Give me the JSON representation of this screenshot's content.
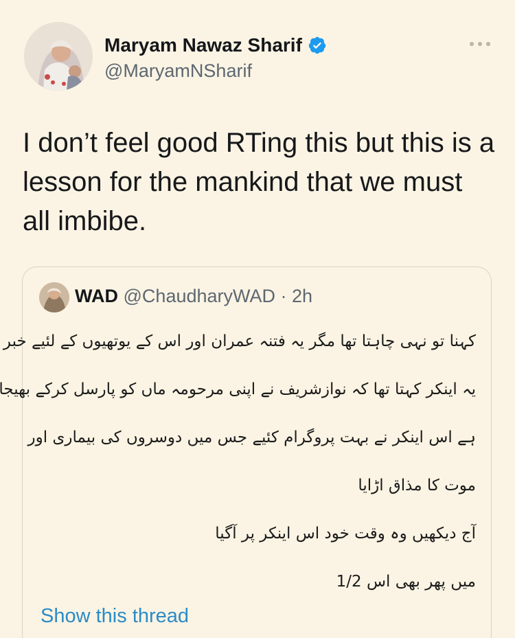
{
  "colors": {
    "background": "#fbf4e4",
    "verified_badge": "#1d9bf0",
    "link": "#2b8bc6",
    "secondary_text": "#5d6770"
  },
  "tweet": {
    "author_name": "Maryam Nawaz Sharif",
    "author_handle": "@MaryamNSharif",
    "verified_icon": "verified-badge-icon",
    "more_icon": "more-options-icon",
    "text": "I don’t feel good RTing this but this is a lesson for the mankind that we must all imbibe."
  },
  "quote": {
    "author_name": "WAD",
    "author_handle": "@ChaudharyWAD",
    "separator": "·",
    "time": "2h",
    "lines": [
      "کہنا تو نہی چاہتا تھا مگر یہ فتنہ عمران اور اس کے یوتھیوں کے لئیے خبر",
      "یہ اینکر کہتا تھا کہ نوازشریف نے اپنی مرحومہ ماں کو پارسل کرکے بھیجا",
      "ہے اس اینکر نے بہت پروگرام کئیے جس میں دوسروں کی بیماری اور",
      "موت کا مذاق اڑایا",
      "آج دیکھیں  وہ وقت خود اس اینکر پر آگیا",
      "میں پھر بھی اس 1/2"
    ],
    "show_thread": "Show this thread"
  }
}
